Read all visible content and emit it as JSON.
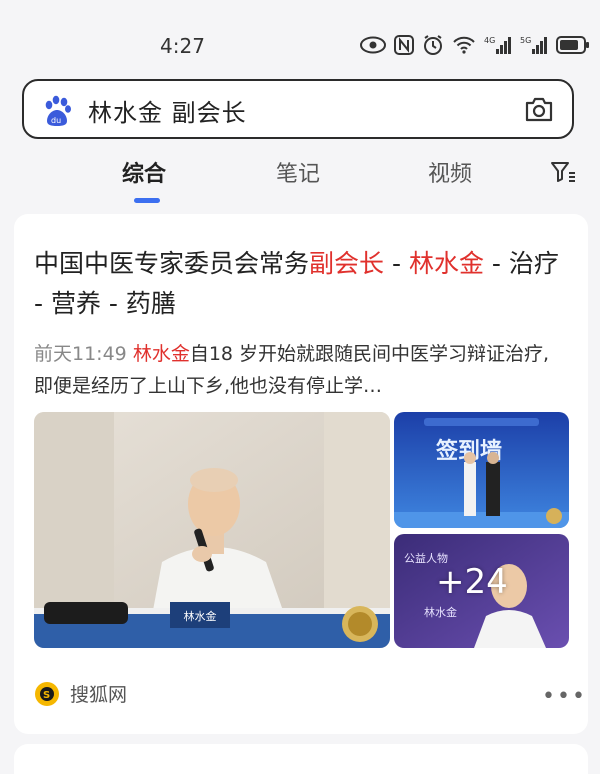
{
  "status_bar": {
    "time": "4:27",
    "icons": [
      "eye-icon",
      "nfc-icon",
      "alarm-icon",
      "wifi-icon",
      "signal-4g-icon",
      "signal-5g-icon",
      "battery-icon"
    ],
    "signal_4g_label": "4G",
    "signal_5g_label": "5G"
  },
  "search": {
    "query": "林水金 副会长"
  },
  "tabs": [
    {
      "label": "综合",
      "active": true
    },
    {
      "label": "笔记",
      "active": false
    },
    {
      "label": "视频",
      "active": false
    }
  ],
  "result": {
    "title_parts": [
      {
        "text": "中国中医专家委员会常务",
        "hl": false
      },
      {
        "text": "副会长",
        "hl": true
      },
      {
        "text": " - ",
        "hl": false
      },
      {
        "text": "林水金",
        "hl": true
      },
      {
        "text": " - 治疗 - 营养 - 药膳",
        "hl": false
      }
    ],
    "date": "前天11:49",
    "snippet_highlight": "林水金",
    "snippet_rest": "自18 岁开始就跟随民间中医学习辩证治疗,即便是经历了上山下乡,他也没有停止学…",
    "photo_nameplate": "林水金",
    "more_count": "+24",
    "thumb_top_banner": "签到墙",
    "thumb_bottom_label": "公益人物",
    "thumb_bottom_name": "林水金",
    "source_name": "搜狐网",
    "more_menu": "•••"
  },
  "colors": {
    "highlight": "#e0312d",
    "accent": "#3c6ff0",
    "background": "#f5f5f7"
  }
}
